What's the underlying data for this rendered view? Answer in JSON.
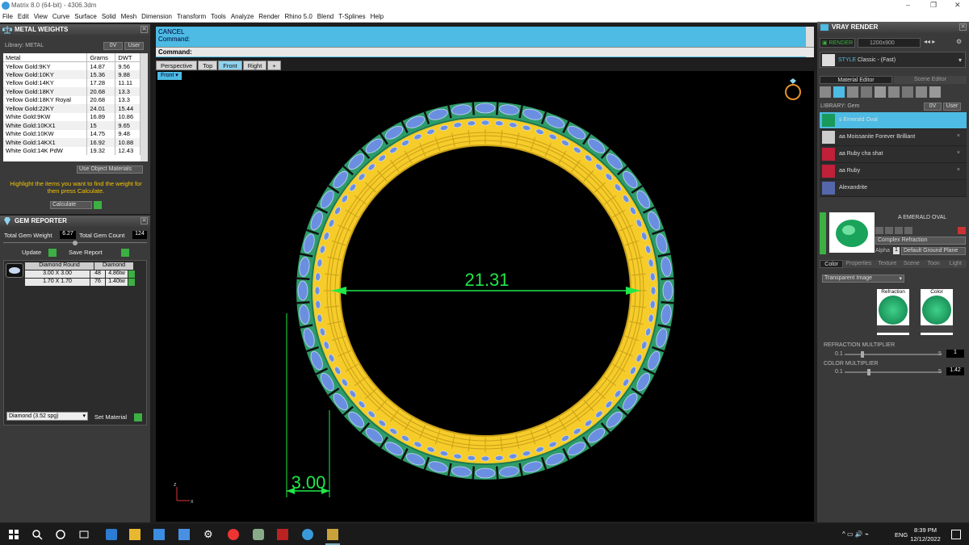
{
  "window": {
    "title": "Matrix 8.0 (64-bit) - 4306.3dm"
  },
  "menu": [
    "File",
    "Edit",
    "View",
    "Curve",
    "Surface",
    "Solid",
    "Mesh",
    "Dimension",
    "Transform",
    "Tools",
    "Analyze",
    "Render",
    "Rhino 5.0",
    "Blend",
    "T-Splines",
    "Help"
  ],
  "metal_weights": {
    "header": "METAL WEIGHTS",
    "library": "Library: METAL",
    "dropdown1": "0V",
    "dropdown2": "User",
    "columns": [
      "Metal",
      "Grams",
      "DWT"
    ],
    "rows": [
      [
        "Yellow Gold:9KY",
        "14.87",
        "9.56"
      ],
      [
        "Yellow Gold:10KY",
        "15.36",
        "9.88"
      ],
      [
        "Yellow Gold:14KY",
        "17.28",
        "11.11"
      ],
      [
        "Yellow Gold:18KY",
        "20.68",
        "13.3"
      ],
      [
        "Yellow Gold:18KY Royal",
        "20.68",
        "13.3"
      ],
      [
        "Yellow Gold:22KY",
        "24.01",
        "15.44"
      ],
      [
        "White Gold:9KW",
        "16.89",
        "10.86"
      ],
      [
        "White Gold:10KX1",
        "15",
        "9.65"
      ],
      [
        "White Gold:10KW",
        "14.75",
        "9.48"
      ],
      [
        "White Gold:14KX1",
        "16.92",
        "10.88"
      ],
      [
        "White Gold:14K PdW",
        "19.32",
        "12.43"
      ]
    ],
    "use_object_materials": "Use Object Materials",
    "hint": "Highlight the items you want to find the weight for then press Calculate.",
    "calculate": "Calculate"
  },
  "gem_reporter": {
    "header": "GEM REPORTER",
    "total_weight_label": "Total Gem Weight",
    "total_weight": "6.27",
    "total_count_label": "Total Gem Count",
    "total_count": "124",
    "update": "Update",
    "save_report": "Save Report",
    "columns": [
      "Diamond Round",
      "Diamond"
    ],
    "rows": [
      [
        "3.00 X 3.00",
        "48",
        "4.86tw"
      ],
      [
        "1.70 X 1.70",
        "76",
        "1.40tw"
      ]
    ],
    "material_select": "Diamond     (3.52 spg)",
    "set_material": "Set Material"
  },
  "command": {
    "line1": "CANCEL",
    "line2": "Command:",
    "prompt": "Command:"
  },
  "viewport_tabs": [
    "Perspective",
    "Top",
    "Front",
    "Right",
    "+"
  ],
  "active_view": "Front",
  "viewport": {
    "dim_diameter": "21.31",
    "dim_width": "3.00",
    "axis_z": "z",
    "axis_x": "x"
  },
  "vray": {
    "header": "VRAY RENDER",
    "render": "RENDER",
    "resolution": "1200x900",
    "style_label": "STYLE",
    "style": "Classic - (Fast)",
    "tab_material": "Material Editor",
    "tab_scene": "Scene Editor",
    "library": "LIBRARY: Gem",
    "lib_dd1": "0V",
    "lib_dd2": "User",
    "materials": [
      "s Emerald Oval",
      "aa Moissanite Forever Brilliant",
      "aa Ruby cha shat",
      "aa Ruby",
      "Alexandrite"
    ],
    "selected_title": "A EMERALD OVAL",
    "shader": "Complex Refraction",
    "alpha": "Alpha",
    "alpha_val": "1",
    "ground": "Default Ground Plane",
    "subtabs": [
      "Color",
      "Properties",
      "Texture",
      "Scene",
      "Toon",
      "Light"
    ],
    "transparent": "Transparent Image",
    "refraction": "Refraction",
    "color": "Color",
    "refraction_multiplier": "REFRACTION MULTIPLIER",
    "rm_min": "0.1",
    "rm_max": "5",
    "rm_val": "1",
    "color_multiplier": "COLOR MULTIPLIER",
    "cm_min": "0.1",
    "cm_max": "5",
    "cm_val": "1.42"
  },
  "taskbar": {
    "lang": "ENG",
    "time": "8:39 PM",
    "date": "12/12/2022"
  },
  "colors": {
    "accent": "#4dbbe3",
    "gold": "#f5cc2a",
    "green_band": "#2e9c6a",
    "gem_blue": "#6b8fe0",
    "dim": "#1fe84a"
  }
}
